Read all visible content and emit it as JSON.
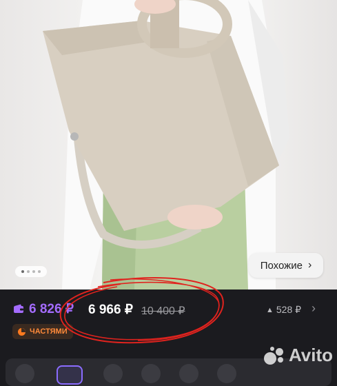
{
  "gallery": {
    "similar_label": "Похожие",
    "page_dots": 4,
    "active_dot": 0
  },
  "price": {
    "bonus_price": "6 826 ₽",
    "current_price": "6 966 ₽",
    "old_price": "10 400 ₽",
    "price_change": "528 ₽"
  },
  "installments_label": "ЧАСТЯМИ",
  "watermark": "Avito",
  "colors": {
    "background": "#1b1b1f",
    "bonus_purple": "#a46cff",
    "installments_orange": "#ff7a1f",
    "annotation_red": "#e0231e"
  }
}
